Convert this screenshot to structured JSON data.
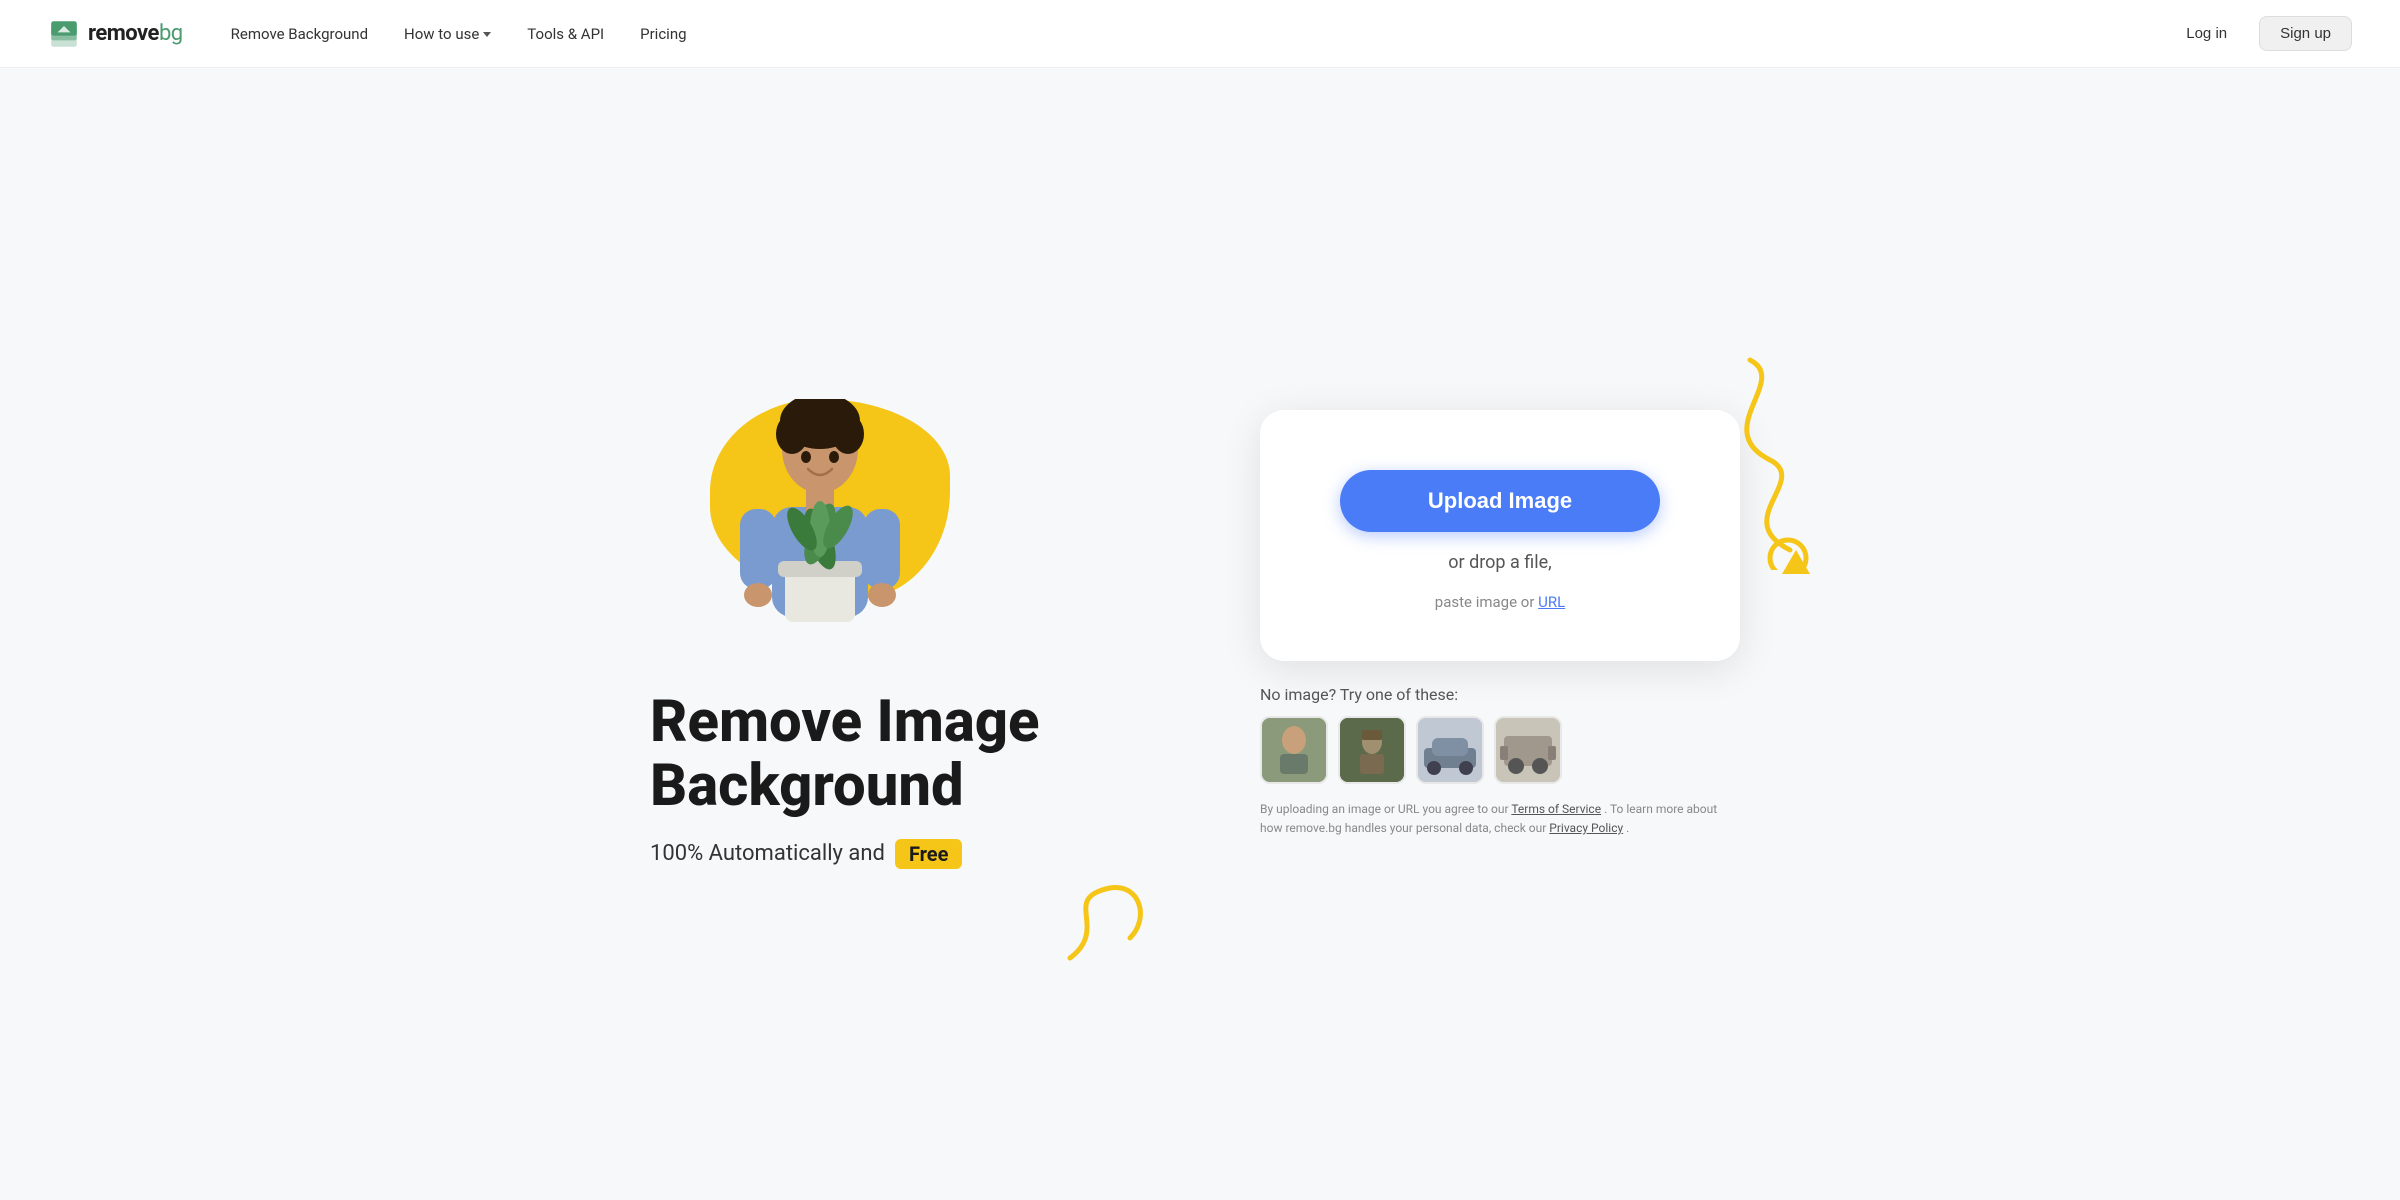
{
  "navbar": {
    "logo_remove": "remove",
    "logo_bg": "bg",
    "nav_items": [
      {
        "label": "Remove Background",
        "has_dropdown": false
      },
      {
        "label": "How to use",
        "has_dropdown": true
      },
      {
        "label": "Tools & API",
        "has_dropdown": false
      },
      {
        "label": "Pricing",
        "has_dropdown": false
      }
    ],
    "login_label": "Log in",
    "signup_label": "Sign up"
  },
  "hero": {
    "heading_line1": "Remove Image",
    "heading_line2": "Background",
    "subtext": "100% Automatically and",
    "free_label": "Free",
    "upload_button_label": "Upload Image",
    "drop_text": "or drop a file,",
    "paste_text": "paste image or",
    "url_label": "URL",
    "sample_label_line1": "No image?",
    "sample_label_line2": "Try one of these:",
    "terms_text": "By uploading an image or URL you agree to our",
    "terms_link": "Terms of Service",
    "terms_text2": ". To learn more about how remove.bg handles your personal data, check our",
    "privacy_link": "Privacy Policy",
    "terms_end": "."
  },
  "colors": {
    "upload_button": "#4a7cf7",
    "yellow_accent": "#f5c518",
    "logo_green": "#4a9c6f"
  }
}
